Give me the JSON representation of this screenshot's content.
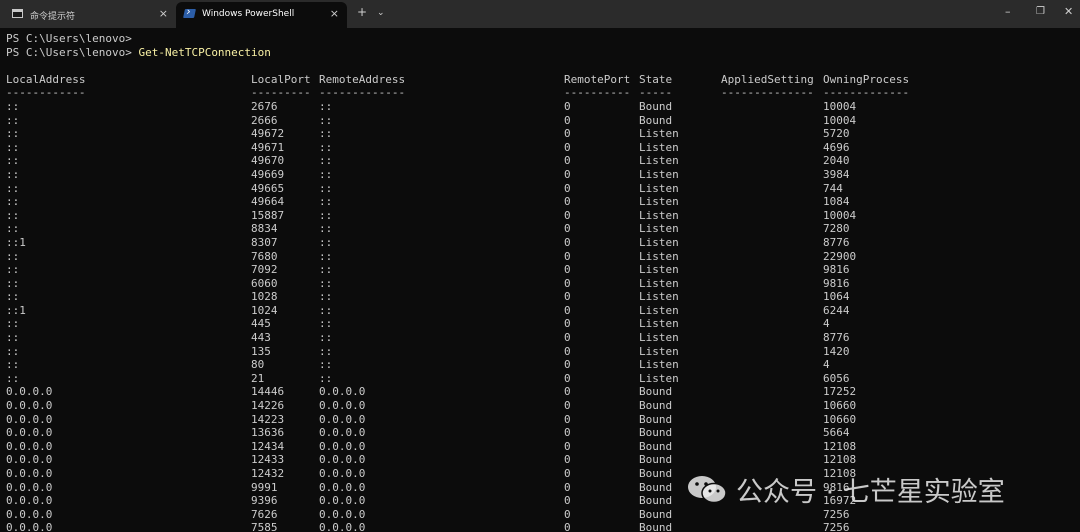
{
  "tabs": [
    {
      "label": "命令提示符",
      "active": false
    },
    {
      "label": "Windows PowerShell",
      "active": true
    }
  ],
  "tab_close_glyph": "×",
  "new_tab_glyph": "+",
  "dropdown_glyph": "⌄",
  "window_controls": {
    "minimize": "–",
    "maximize": "❐",
    "close": "✕"
  },
  "console": {
    "prompt1": "PS C:\\Users\\lenovo>",
    "prompt2": "PS C:\\Users\\lenovo>",
    "command": " Get-NetTCPConnection",
    "columns": [
      "LocalAddress",
      "LocalPort",
      "RemoteAddress",
      "RemotePort",
      "State",
      "AppliedSetting",
      "OwningProcess"
    ],
    "underlines": [
      "------------",
      "---------",
      "-------------",
      "----------",
      "-----",
      "--------------",
      "-------------"
    ],
    "rows": [
      [
        "::",
        "2676",
        "::",
        "0",
        "Bound",
        "",
        "10004"
      ],
      [
        "::",
        "2666",
        "::",
        "0",
        "Bound",
        "",
        "10004"
      ],
      [
        "::",
        "49672",
        "::",
        "0",
        "Listen",
        "",
        "5720"
      ],
      [
        "::",
        "49671",
        "::",
        "0",
        "Listen",
        "",
        "4696"
      ],
      [
        "::",
        "49670",
        "::",
        "0",
        "Listen",
        "",
        "2040"
      ],
      [
        "::",
        "49669",
        "::",
        "0",
        "Listen",
        "",
        "3984"
      ],
      [
        "::",
        "49665",
        "::",
        "0",
        "Listen",
        "",
        "744"
      ],
      [
        "::",
        "49664",
        "::",
        "0",
        "Listen",
        "",
        "1084"
      ],
      [
        "::",
        "15887",
        "::",
        "0",
        "Listen",
        "",
        "10004"
      ],
      [
        "::",
        "8834",
        "::",
        "0",
        "Listen",
        "",
        "7280"
      ],
      [
        "::1",
        "8307",
        "::",
        "0",
        "Listen",
        "",
        "8776"
      ],
      [
        "::",
        "7680",
        "::",
        "0",
        "Listen",
        "",
        "22900"
      ],
      [
        "::",
        "7092",
        "::",
        "0",
        "Listen",
        "",
        "9816"
      ],
      [
        "::",
        "6060",
        "::",
        "0",
        "Listen",
        "",
        "9816"
      ],
      [
        "::",
        "1028",
        "::",
        "0",
        "Listen",
        "",
        "1064"
      ],
      [
        "::1",
        "1024",
        "::",
        "0",
        "Listen",
        "",
        "6244"
      ],
      [
        "::",
        "445",
        "::",
        "0",
        "Listen",
        "",
        "4"
      ],
      [
        "::",
        "443",
        "::",
        "0",
        "Listen",
        "",
        "8776"
      ],
      [
        "::",
        "135",
        "::",
        "0",
        "Listen",
        "",
        "1420"
      ],
      [
        "::",
        "80",
        "::",
        "0",
        "Listen",
        "",
        "4"
      ],
      [
        "::",
        "21",
        "::",
        "0",
        "Listen",
        "",
        "6056"
      ],
      [
        "0.0.0.0",
        "14446",
        "0.0.0.0",
        "0",
        "Bound",
        "",
        "17252"
      ],
      [
        "0.0.0.0",
        "14226",
        "0.0.0.0",
        "0",
        "Bound",
        "",
        "10660"
      ],
      [
        "0.0.0.0",
        "14223",
        "0.0.0.0",
        "0",
        "Bound",
        "",
        "10660"
      ],
      [
        "0.0.0.0",
        "13636",
        "0.0.0.0",
        "0",
        "Bound",
        "",
        "5664"
      ],
      [
        "0.0.0.0",
        "12434",
        "0.0.0.0",
        "0",
        "Bound",
        "",
        "12108"
      ],
      [
        "0.0.0.0",
        "12433",
        "0.0.0.0",
        "0",
        "Bound",
        "",
        "12108"
      ],
      [
        "0.0.0.0",
        "12432",
        "0.0.0.0",
        "0",
        "Bound",
        "",
        "12108"
      ],
      [
        "0.0.0.0",
        "9991",
        "0.0.0.0",
        "0",
        "Bound",
        "",
        "9816"
      ],
      [
        "0.0.0.0",
        "9396",
        "0.0.0.0",
        "0",
        "Bound",
        "",
        "16972"
      ],
      [
        "0.0.0.0",
        "7626",
        "0.0.0.0",
        "0",
        "Bound",
        "",
        "7256"
      ],
      [
        "0.0.0.0",
        "7585",
        "0.0.0.0",
        "0",
        "Bound",
        "",
        "7256"
      ]
    ]
  },
  "watermark": {
    "text": "公众号 · 七芒星实验室",
    "icon": "wechat-icon"
  },
  "colors": {
    "background": "#0c0c0c",
    "titlebar": "#2b2b2b",
    "text": "#cccccc",
    "command": "#f9f1a5"
  }
}
